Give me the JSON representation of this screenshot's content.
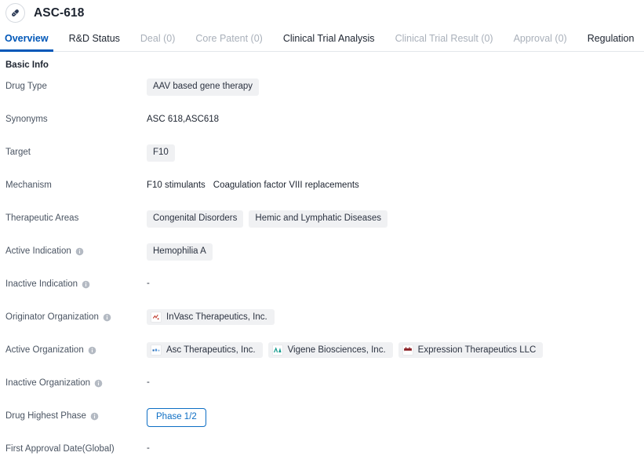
{
  "header": {
    "icon": "pill-capsule-icon",
    "title": "ASC-618"
  },
  "tabs": [
    {
      "label": "Overview",
      "state": "active"
    },
    {
      "label": "R&D Status",
      "state": "normal"
    },
    {
      "label": "Deal (0)",
      "state": "disabled"
    },
    {
      "label": "Core Patent (0)",
      "state": "disabled"
    },
    {
      "label": "Clinical Trial Analysis",
      "state": "normal"
    },
    {
      "label": "Clinical Trial Result (0)",
      "state": "disabled"
    },
    {
      "label": "Approval (0)",
      "state": "disabled"
    },
    {
      "label": "Regulation",
      "state": "normal"
    }
  ],
  "section": {
    "title": "Basic Info"
  },
  "fields": {
    "drug_type": {
      "label": "Drug Type",
      "chips": [
        "AAV based gene therapy"
      ]
    },
    "synonyms": {
      "label": "Synonyms",
      "text": "ASC 618,ASC618"
    },
    "target": {
      "label": "Target",
      "chips": [
        "F10"
      ]
    },
    "mechanism": {
      "label": "Mechanism",
      "items": [
        "F10 stimulants",
        "Coagulation factor VIII replacements"
      ]
    },
    "therapeutic_areas": {
      "label": "Therapeutic Areas",
      "chips": [
        "Congenital Disorders",
        "Hemic and Lymphatic Diseases"
      ]
    },
    "active_indication": {
      "label": "Active Indication",
      "has_info": true,
      "chips": [
        "Hemophilia A"
      ]
    },
    "inactive_indication": {
      "label": "Inactive Indication",
      "has_info": true,
      "text": "-"
    },
    "originator_organization": {
      "label": "Originator Organization",
      "has_info": true,
      "orgs": [
        {
          "name": "InVasc Therapeutics, Inc.",
          "logo": "invasc-logo",
          "logo_color": "#c0392b"
        }
      ]
    },
    "active_organization": {
      "label": "Active Organization",
      "has_info": true,
      "orgs": [
        {
          "name": "Asc Therapeutics, Inc.",
          "logo": "asc-logo",
          "logo_color": "#2f6fb5"
        },
        {
          "name": "Vigene Biosciences, Inc.",
          "logo": "vigene-logo",
          "logo_color": "#169b8e"
        },
        {
          "name": "Expression Therapeutics LLC",
          "logo": "expression-logo",
          "logo_color": "#8b1f24"
        }
      ]
    },
    "inactive_organization": {
      "label": "Inactive Organization",
      "has_info": true,
      "text": "-"
    },
    "drug_highest_phase": {
      "label": "Drug Highest Phase",
      "has_info": true,
      "badge": "Phase 1/2",
      "badge_color": "#0d6ec4"
    },
    "first_approval_date": {
      "label": "First Approval Date(Global)",
      "text": "-"
    }
  },
  "colors": {
    "accent": "#0057b8",
    "chip_bg": "#f0f1f3",
    "text": "#1d2430",
    "muted": "#a9b0ba"
  }
}
